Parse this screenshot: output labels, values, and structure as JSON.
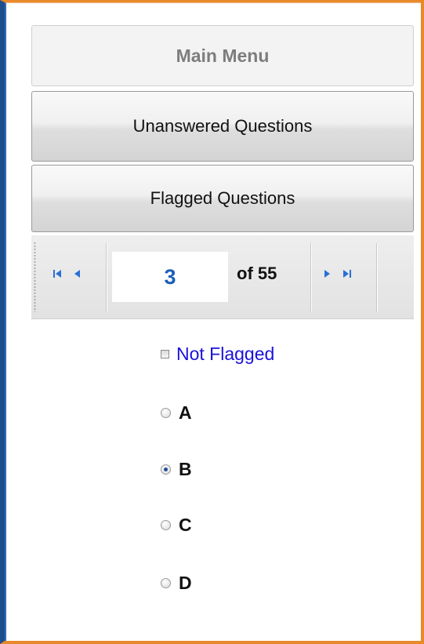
{
  "menu": {
    "main_menu": "Main Menu",
    "unanswered": "Unanswered Questions",
    "flagged": "Flagged Questions"
  },
  "pager": {
    "current_page": "3",
    "of_total": "of 55",
    "icons": {
      "first": "first-page-icon",
      "prev": "previous-page-icon",
      "next": "next-page-icon",
      "last": "last-page-icon"
    }
  },
  "flag": {
    "label": "Not Flagged",
    "checked": false
  },
  "options": [
    {
      "label": "A",
      "selected": false
    },
    {
      "label": "B",
      "selected": true
    },
    {
      "label": "C",
      "selected": false
    },
    {
      "label": "D",
      "selected": false
    }
  ],
  "colors": {
    "frame_orange": "#e8892a",
    "frame_blue": "#1f4e8c",
    "page_number_blue": "#1c5fb8",
    "flag_label_blue": "#1a12d8",
    "nav_icon_blue": "#2b6fd6"
  }
}
